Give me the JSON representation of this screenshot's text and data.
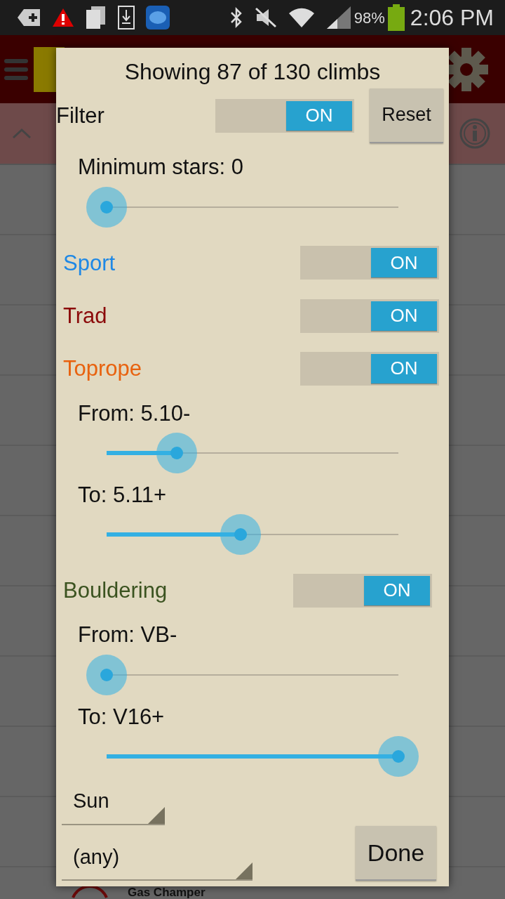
{
  "status_bar": {
    "battery": "98%",
    "time": "2:06 PM"
  },
  "background_list": {
    "visible_item": "Gas Champer"
  },
  "dialog": {
    "title": "Showing 87 of 130 climbs",
    "filter": {
      "label": "Filter",
      "on": true,
      "toggle_text": "ON"
    },
    "reset_button": "Reset",
    "min_stars": {
      "label": "Minimum stars: 0",
      "level": 0
    },
    "categories": [
      {
        "name": "Sport",
        "color": "#1e88e5",
        "on": true,
        "toggle_text": "ON"
      },
      {
        "name": "Trad",
        "color": "#8b0a0a",
        "on": true,
        "toggle_text": "ON"
      },
      {
        "name": "Toprope",
        "color": "#e8620f",
        "on": true,
        "toggle_text": "ON",
        "ranges": [
          {
            "label": "From: 5.10-",
            "level": 0.24
          },
          {
            "label": "To: 5.11+",
            "level": 0.46
          }
        ]
      },
      {
        "name": "Bouldering",
        "color": "#3b5320",
        "on": true,
        "toggle_text": "ON",
        "ranges": [
          {
            "label": "From: VB-",
            "level": 0
          },
          {
            "label": "To: V16+",
            "level": 1
          }
        ]
      }
    ],
    "spinners": [
      {
        "value": "Sun"
      },
      {
        "value": "(any)"
      }
    ],
    "done_button": "Done"
  }
}
